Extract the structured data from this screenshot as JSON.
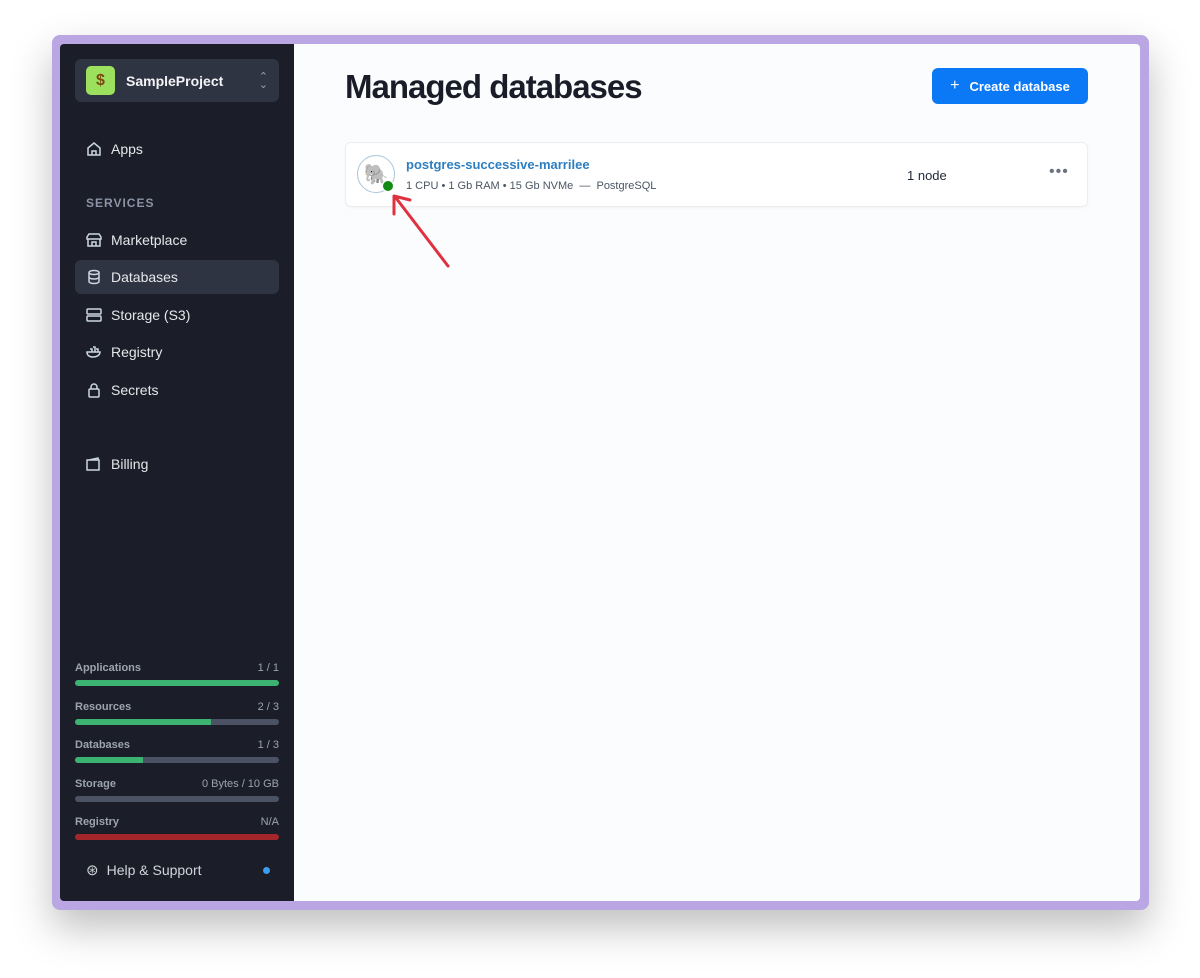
{
  "project": {
    "name": "SampleProject",
    "logo": "money-bag"
  },
  "nav": {
    "apps": "Apps",
    "services_label": "SERVICES",
    "marketplace": "Marketplace",
    "databases": "Databases",
    "storage": "Storage (S3)",
    "registry": "Registry",
    "secrets": "Secrets",
    "billing": "Billing"
  },
  "usage": [
    {
      "label": "Applications",
      "value": "1 / 1",
      "fraction": 1.0,
      "color": "#3cb371"
    },
    {
      "label": "Resources",
      "value": "2 / 3",
      "fraction": 0.667,
      "color": "#3cb371"
    },
    {
      "label": "Databases",
      "value": "1 / 3",
      "fraction": 0.333,
      "color": "#3cb371"
    },
    {
      "label": "Storage",
      "value": "0 Bytes / 10 GB",
      "fraction": 0,
      "color": "#3cb371"
    },
    {
      "label": "Registry",
      "value": "N/A",
      "fraction": 1.0,
      "color": "#a3272a"
    }
  ],
  "help": "Help & Support",
  "main": {
    "title": "Managed databases",
    "create_label": "Create database"
  },
  "databases": [
    {
      "name": "postgres-successive-marrilee",
      "meta": "1 CPU • 1 Gb RAM • 15 Gb NVMe  —  PostgreSQL",
      "nodes": "1 node",
      "status": "running",
      "status_color": "#138a13"
    }
  ]
}
